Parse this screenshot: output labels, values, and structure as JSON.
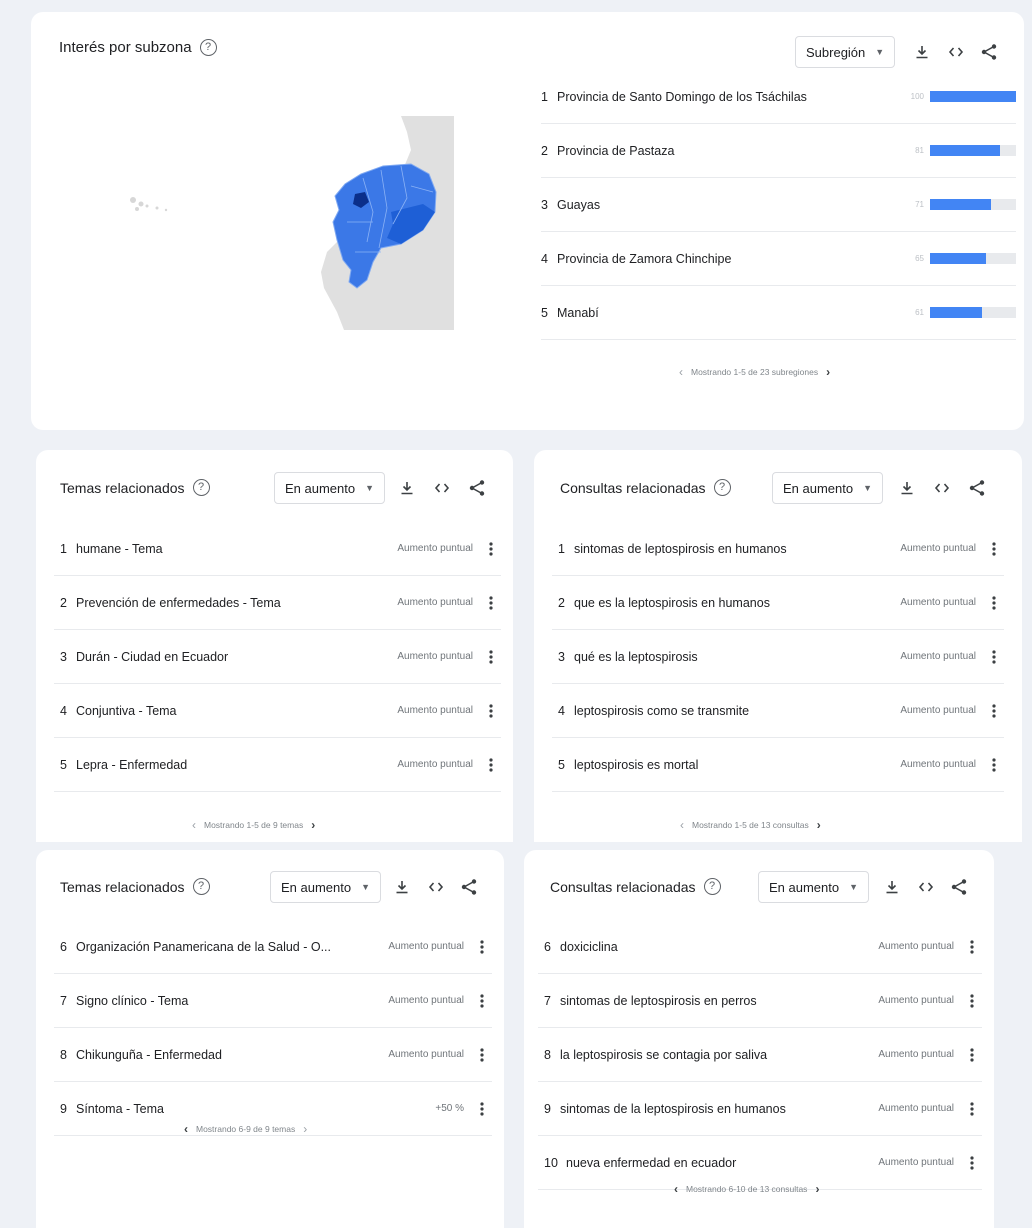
{
  "subzone": {
    "title": "Interés por subzona",
    "select": "Subregión",
    "regions": [
      {
        "rank": "1",
        "name": "Provincia de Santo Domingo de los Tsáchilas",
        "value": 100
      },
      {
        "rank": "2",
        "name": "Provincia de Pastaza",
        "value": 81
      },
      {
        "rank": "3",
        "name": "Guayas",
        "value": 71
      },
      {
        "rank": "4",
        "name": "Provincia de Zamora Chinchipe",
        "value": 65
      },
      {
        "rank": "5",
        "name": "Manabí",
        "value": 61
      }
    ],
    "pager": "Mostrando 1-5 de 23 subregiones"
  },
  "topics_1": {
    "title": "Temas relacionados",
    "select": "En aumento",
    "rows": [
      {
        "rank": "1",
        "label": "humane - Tema",
        "value": "Aumento puntual"
      },
      {
        "rank": "2",
        "label": "Prevención de enfermedades - Tema",
        "value": "Aumento puntual"
      },
      {
        "rank": "3",
        "label": "Durán - Ciudad en Ecuador",
        "value": "Aumento puntual"
      },
      {
        "rank": "4",
        "label": "Conjuntiva - Tema",
        "value": "Aumento puntual"
      },
      {
        "rank": "5",
        "label": "Lepra - Enfermedad",
        "value": "Aumento puntual"
      }
    ],
    "pager": "Mostrando 1-5 de 9 temas"
  },
  "queries_1": {
    "title": "Consultas relacionadas",
    "select": "En aumento",
    "rows": [
      {
        "rank": "1",
        "label": "sintomas de leptospirosis en humanos",
        "value": "Aumento puntual"
      },
      {
        "rank": "2",
        "label": "que es la leptospirosis en humanos",
        "value": "Aumento puntual"
      },
      {
        "rank": "3",
        "label": "qué es la leptospirosis",
        "value": "Aumento puntual"
      },
      {
        "rank": "4",
        "label": "leptospirosis como se transmite",
        "value": "Aumento puntual"
      },
      {
        "rank": "5",
        "label": "leptospirosis es mortal",
        "value": "Aumento puntual"
      }
    ],
    "pager": "Mostrando 1-5 de 13 consultas"
  },
  "topics_2": {
    "title": "Temas relacionados",
    "select": "En aumento",
    "rows": [
      {
        "rank": "6",
        "label": "Organización Panamericana de la Salud - O...",
        "value": "Aumento puntual"
      },
      {
        "rank": "7",
        "label": "Signo clínico - Tema",
        "value": "Aumento puntual"
      },
      {
        "rank": "8",
        "label": "Chikunguña - Enfermedad",
        "value": "Aumento puntual"
      },
      {
        "rank": "9",
        "label": "Síntoma - Tema",
        "value": "+50 %"
      }
    ],
    "pager": "Mostrando 6-9 de 9 temas"
  },
  "queries_2": {
    "title": "Consultas relacionadas",
    "select": "En aumento",
    "rows": [
      {
        "rank": "6",
        "label": "doxiciclina",
        "value": "Aumento puntual"
      },
      {
        "rank": "7",
        "label": "sintomas de leptospirosis en perros",
        "value": "Aumento puntual"
      },
      {
        "rank": "8",
        "label": "la leptospirosis se contagia por saliva",
        "value": "Aumento puntual"
      },
      {
        "rank": "9",
        "label": "sintomas de la leptospirosis en humanos",
        "value": "Aumento puntual"
      },
      {
        "rank": "10",
        "label": "nueva enfermedad en ecuador",
        "value": "Aumento puntual"
      }
    ],
    "pager": "Mostrando 6-10 de 13 consultas"
  },
  "colors": {
    "bar": "#4285f4",
    "map_land": "#e0e0e0",
    "map_fill": "#3b78e7"
  },
  "icons": [
    "help-icon",
    "chevron-down-icon",
    "download-icon",
    "embed-icon",
    "share-icon",
    "more-vert-icon",
    "chevron-left-icon",
    "chevron-right-icon"
  ]
}
